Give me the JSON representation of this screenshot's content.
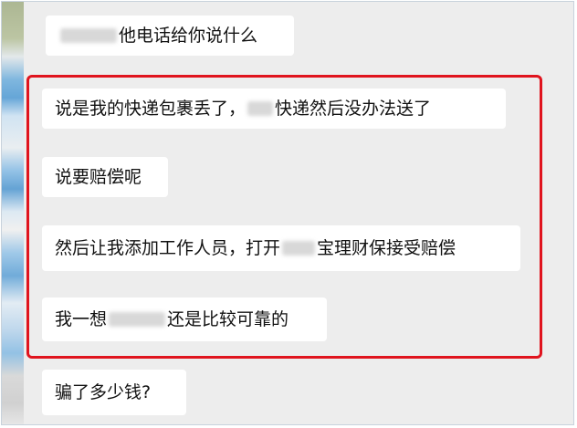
{
  "messages": [
    {
      "id": "m1",
      "before": "",
      "after": "他电话给你说什么"
    },
    {
      "id": "m2",
      "before": "说是我的快递包裹丢了，",
      "after": "快递然后没办法送了"
    },
    {
      "id": "m3",
      "before": "",
      "after": "说要赔偿呢"
    },
    {
      "id": "m4",
      "before": "然后让我添加工作人员，打开",
      "after": "宝理财保接受赔偿"
    },
    {
      "id": "m5",
      "before": "我一想",
      "after": "还是比较可靠的"
    },
    {
      "id": "m6",
      "before": "",
      "after": "骗了多少钱?"
    }
  ],
  "colors": {
    "highlight_border": "#e0141e",
    "chat_background": "#ededed",
    "bubble": "#ffffff"
  }
}
